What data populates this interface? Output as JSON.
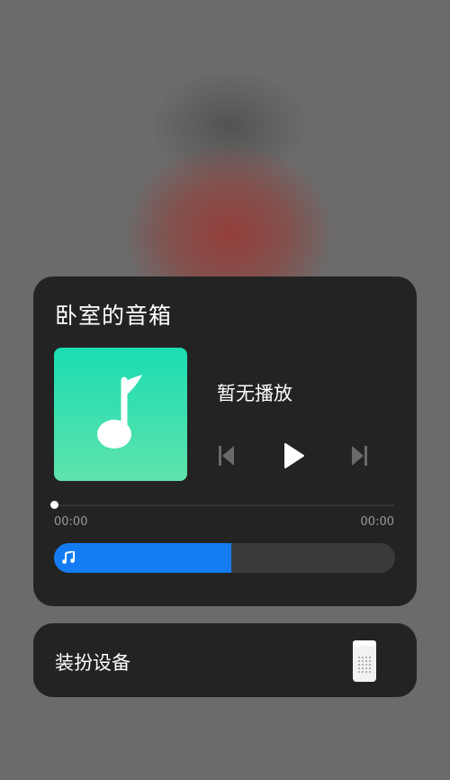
{
  "player": {
    "title": "卧室的音箱",
    "track": "暂无播放",
    "elapsed": "00:00",
    "duration": "00:00",
    "progress_fraction": 0,
    "volume_fraction": 0.52,
    "album_art_icon": "music-note-icon",
    "controls": {
      "prev_icon": "skip-previous-icon",
      "play_icon": "play-icon",
      "next_icon": "skip-next-icon"
    },
    "volume_icon": "music-note-icon"
  },
  "device": {
    "label": "装扮设备",
    "icon": "smart-speaker-icon"
  },
  "colors": {
    "accent": "#137cf2",
    "card_bg": "#232323",
    "album_gradient_top": "#1bdcb3",
    "album_gradient_bottom": "#5fe3ab"
  }
}
